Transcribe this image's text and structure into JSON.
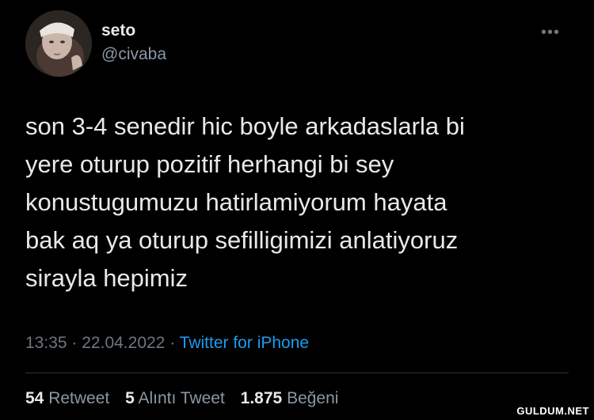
{
  "author": {
    "name": "seto",
    "handle": "@civaba"
  },
  "tweet": {
    "text": "son 3-4 senedir hic boyle arkadaslarla bi\nyere oturup pozitif herhangi bi sey\nkonustugumuzu hatirlamiyorum hayata\nbak aq ya oturup sefilligimizi anlatiyoruz\nsirayla hepimiz",
    "time": "13:35",
    "date": "22.04.2022",
    "source": "Twitter for iPhone",
    "separator": "·"
  },
  "stats": {
    "retweets": "54",
    "retweets_label": "Retweet",
    "quotes": "5",
    "quotes_label": "Alıntı Tweet",
    "likes": "1.875",
    "likes_label": "Beğeni"
  },
  "more_icon": "more-horizontal-icon",
  "watermark": "GULDUM.NET"
}
